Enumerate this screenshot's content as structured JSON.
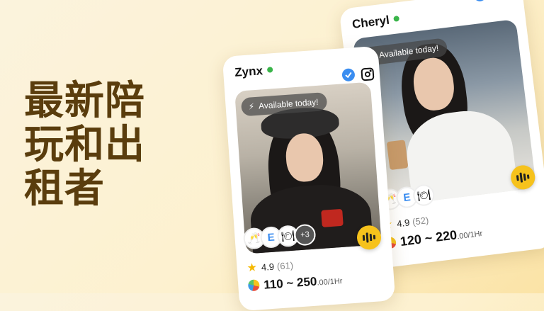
{
  "headline": {
    "lines": [
      "最新陪",
      "玩和出",
      "租者"
    ]
  },
  "cards": [
    {
      "name": "Zynx",
      "availability": "Available today!",
      "games_more": "+3",
      "rating": "4.9",
      "rating_count": "(61)",
      "price_range": "110 ~ 250",
      "price_unit": ".00/1Hr"
    },
    {
      "name": "Cheryl",
      "availability": "Available today!",
      "rating": "4.9",
      "rating_count": "(52)",
      "price_range": "120 ~ 220",
      "price_unit": ".00/1Hr"
    }
  ],
  "colors": {
    "accent": "#f6c21c",
    "headline": "#5a3d0d",
    "online": "#3ab54a",
    "verified": "#3a8df0"
  },
  "icons": [
    "verified-badge-icon",
    "instagram-icon",
    "lightning-icon",
    "voice-icon",
    "star-icon",
    "coin-icon",
    "champagne-icon",
    "game-e-icon",
    "dining-icon"
  ]
}
